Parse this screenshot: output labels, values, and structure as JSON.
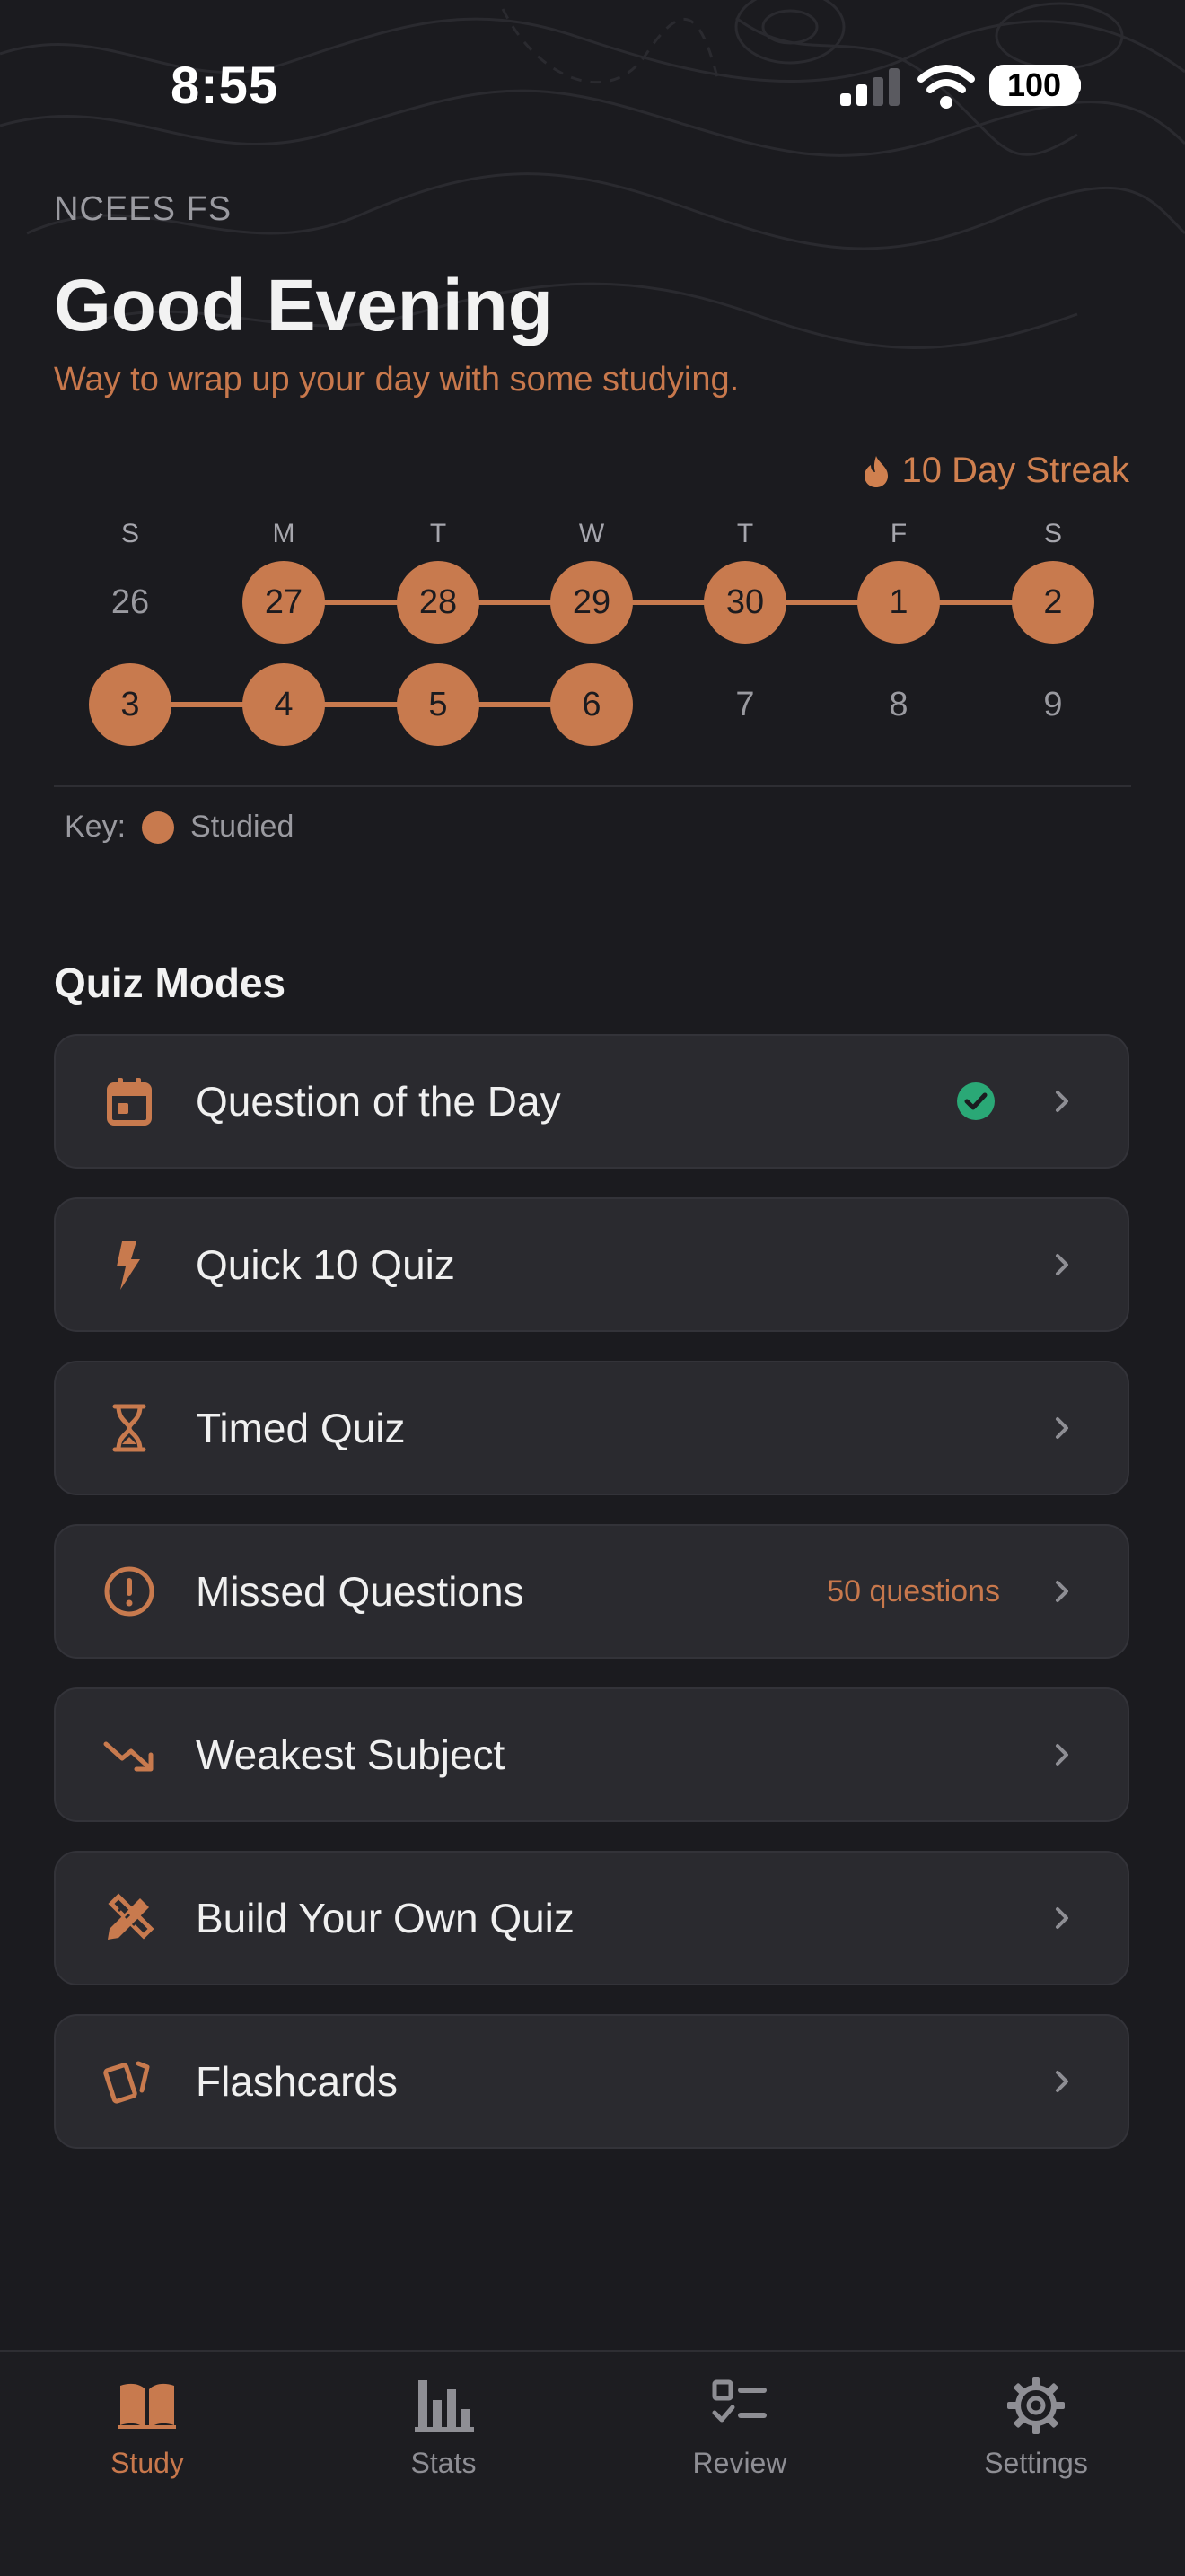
{
  "status_bar": {
    "time": "8:55",
    "battery": "100"
  },
  "header": {
    "exam": "NCEES FS",
    "greeting": "Good Evening",
    "subtitle": "Way to wrap up your day with some studying."
  },
  "streak": {
    "label": "10 Day Streak",
    "icon": "flame-icon"
  },
  "calendar": {
    "weekdays": [
      "S",
      "M",
      "T",
      "W",
      "T",
      "F",
      "S"
    ],
    "weeks": [
      [
        {
          "day": "26",
          "studied": false
        },
        {
          "day": "27",
          "studied": true
        },
        {
          "day": "28",
          "studied": true
        },
        {
          "day": "29",
          "studied": true
        },
        {
          "day": "30",
          "studied": true
        },
        {
          "day": "1",
          "studied": true
        },
        {
          "day": "2",
          "studied": true
        }
      ],
      [
        {
          "day": "3",
          "studied": true
        },
        {
          "day": "4",
          "studied": true
        },
        {
          "day": "5",
          "studied": true
        },
        {
          "day": "6",
          "studied": true
        },
        {
          "day": "7",
          "studied": false
        },
        {
          "day": "8",
          "studied": false
        },
        {
          "day": "9",
          "studied": false
        }
      ]
    ],
    "key_label": "Key:",
    "key_studied": "Studied"
  },
  "quiz_modes": {
    "title": "Quiz Modes",
    "items": [
      {
        "label": "Question of the Day",
        "icon": "calendar-icon",
        "completed": true
      },
      {
        "label": "Quick 10 Quiz",
        "icon": "lightning-icon"
      },
      {
        "label": "Timed Quiz",
        "icon": "hourglass-icon"
      },
      {
        "label": "Missed Questions",
        "icon": "exclamation-circle-icon",
        "badge": "50 questions"
      },
      {
        "label": "Weakest Subject",
        "icon": "trending-down-icon"
      },
      {
        "label": "Build Your Own Quiz",
        "icon": "pencil-ruler-icon"
      },
      {
        "label": "Flashcards",
        "icon": "cards-icon"
      }
    ]
  },
  "tabs": [
    {
      "label": "Study",
      "icon": "book-icon",
      "active": true
    },
    {
      "label": "Stats",
      "icon": "bar-chart-icon",
      "active": false
    },
    {
      "label": "Review",
      "icon": "checklist-icon",
      "active": false
    },
    {
      "label": "Settings",
      "icon": "gear-icon",
      "active": false
    }
  ],
  "colors": {
    "accent": "#c87a4e",
    "background": "#1b1b1f",
    "card": "#2a2a2f",
    "success": "#2aa876"
  }
}
